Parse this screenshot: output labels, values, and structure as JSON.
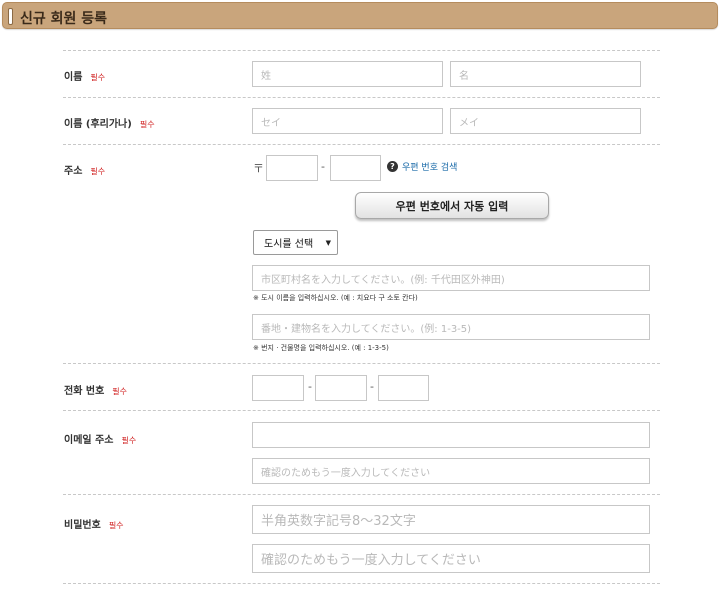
{
  "header": {
    "title": "신규 회원 등록"
  },
  "required_mark": "필수",
  "rows": {
    "name": {
      "label": "이름",
      "last_placeholder": "姓",
      "first_placeholder": "名"
    },
    "furigana": {
      "label": "이름 (후리가나)",
      "last_placeholder": "セイ",
      "first_placeholder": "メイ"
    },
    "address": {
      "label": "주소",
      "zip_mark": "〒",
      "zip_separator": "-",
      "help_link": "우편 번호 검색",
      "autofill_button": "우편 번호에서 자동 입력",
      "prefecture_select": "도시를 선택",
      "city_placeholder": "市区町村名を入力してください。(例: 千代田区外神田)",
      "city_note": "※ 도시 이름을 입력하십시오. (예 : 치요다 구 소토 칸다)",
      "street_placeholder": "番地・建物名を入力してください。(例: 1-3-5)",
      "street_note": "※ 번지 · 건물명을 입력하십시오. (예 : 1-3-5)"
    },
    "phone": {
      "label": "전화 번호",
      "separator": "-"
    },
    "email": {
      "label": "이메일 주소",
      "confirm_placeholder": "確認のためもう一度入力してください"
    },
    "password": {
      "label": "비밀번호",
      "placeholder": "半角英数字記号8～32文字",
      "confirm_placeholder": "確認のためもう一度入力してください"
    }
  }
}
